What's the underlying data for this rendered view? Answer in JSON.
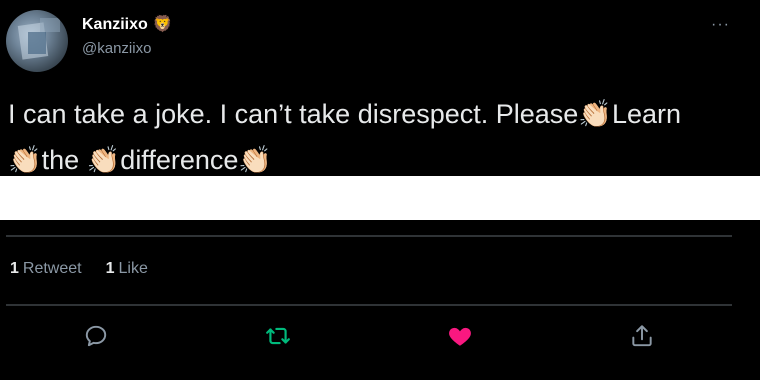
{
  "user": {
    "display_name": "Kanziixo",
    "badge_emoji": "🦁",
    "handle": "@kanziixo"
  },
  "more_icon": "···",
  "tweet": {
    "line1": [
      {
        "type": "text",
        "value": "I can take a joke. I can’t take disrespect. Please"
      },
      {
        "type": "emoji",
        "value": "👏🏻"
      },
      {
        "type": "text",
        "value": "Learn"
      }
    ],
    "line2": [
      {
        "type": "emoji",
        "value": "👏🏻"
      },
      {
        "type": "text",
        "value": "the "
      },
      {
        "type": "emoji",
        "value": "👏🏻"
      },
      {
        "type": "text",
        "value": "difference"
      },
      {
        "type": "emoji",
        "value": "👏🏻"
      }
    ]
  },
  "stats": {
    "retweets_count": "1",
    "retweets_label": "Retweet",
    "likes_count": "1",
    "likes_label": "Like"
  },
  "actions": {
    "reply_icon": "reply-icon",
    "retweet_icon": "retweet-icon",
    "like_icon": "heart-icon",
    "share_icon": "share-icon"
  },
  "colors": {
    "background": "#000000",
    "primary_text": "#e7e9ea",
    "secondary_text": "#8b98a5",
    "divider": "#2f3336",
    "retweet_green": "#00ba7c",
    "like_pink": "#f91880"
  }
}
